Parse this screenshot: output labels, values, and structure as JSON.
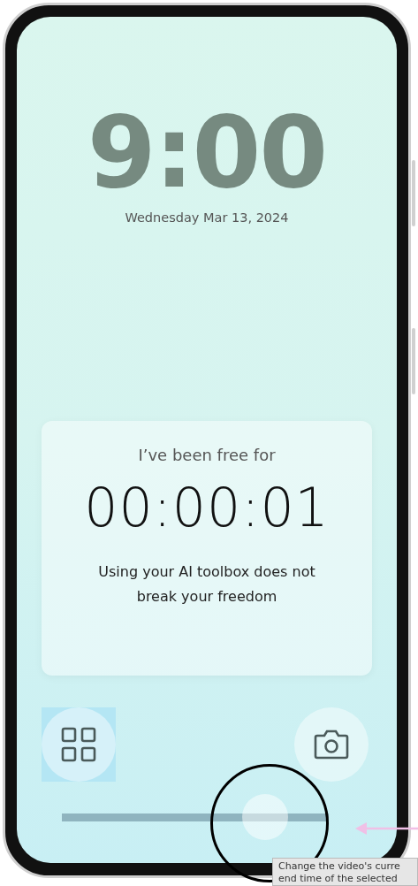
{
  "lock_screen": {
    "time": "9:00",
    "date": "Wednesday Mar 13, 2024"
  },
  "card": {
    "heading": "I’ve been free for",
    "timer": "00:00:01",
    "message": "Using your AI toolbox does not break your freedom"
  },
  "shortcuts": [
    {
      "kind": "apps",
      "selected": true
    },
    {
      "kind": "camera",
      "selected": false
    }
  ],
  "scrubber": {
    "level": 0.76
  },
  "tooltip": {
    "lines": [
      "Change the video's curre",
      "end time of the selected"
    ]
  }
}
